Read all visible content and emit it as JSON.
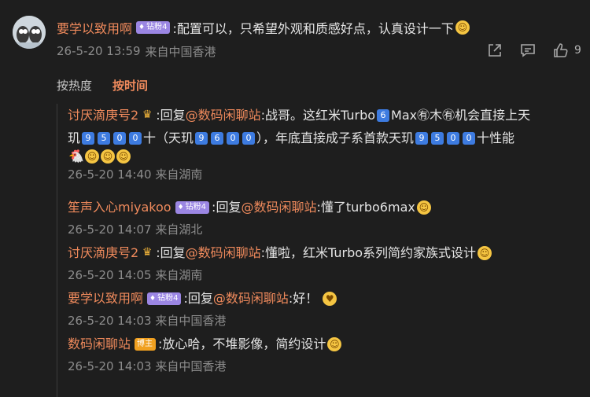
{
  "top_comment": {
    "username": "要学以致用啊",
    "badge": "钻粉4",
    "text": ":配置可以，只希望外观和质感好点，认真设计一下",
    "timestamp": "26-5-20 13:59",
    "location": "来自中国香港",
    "like_count": "9"
  },
  "sort": {
    "hot": "按热度",
    "time": "按时间"
  },
  "replies": [
    {
      "username": "讨厌滴庚号2",
      "prefix": ":回复",
      "mention": "@数码闲聊站",
      "seg1": ":战哥。这红米Turbo",
      "k1": "6",
      "seg2": " Max㊒木㊒机会直接上天",
      "line2_a": "玑",
      "chip_a": [
        "9",
        "5",
        "0",
        "0"
      ],
      "line2_b": "十（天玑",
      "chip_b": [
        "9",
        "6",
        "0",
        "0"
      ],
      "line2_c": "），年底直接成子系首款天玑",
      "chip_c": [
        "9",
        "5",
        "0",
        "0"
      ],
      "line2_d": "十性能",
      "timestamp": "26-5-20 14:40",
      "location": "来自湖南"
    },
    {
      "username": "笙声入心miyakoo",
      "badge": "钻粉4",
      "prefix": ":回复",
      "mention": "@数码闲聊站",
      "text": ":懂了turbo6max",
      "timestamp": "26-5-20 14:07",
      "location": "来自湖北"
    },
    {
      "username": "讨厌滴庚号2",
      "prefix": ":回复",
      "mention": "@数码闲聊站",
      "text": ":懂啦，红米Turbo系列简约家族式设计",
      "timestamp": "26-5-20 14:05",
      "location": "来自湖南"
    },
    {
      "username": "要学以致用啊",
      "badge": "钻粉4",
      "prefix": ":回复",
      "mention": "@数码闲聊站",
      "text": ":好！",
      "timestamp": "26-5-20 14:03",
      "location": "来自中国香港"
    },
    {
      "username": "数码闲聊站",
      "badge": "博主",
      "text": ":放心哈，不堆影像，简约设计",
      "timestamp": "26-5-20 14:03",
      "location": "来自中国香港"
    }
  ],
  "colors": {
    "background": "#1e1e1e",
    "username": "#ef8a5c",
    "badge_fan": "#9b86e3",
    "badge_owner": "#f0a020",
    "keycap": "#3d7be0"
  }
}
